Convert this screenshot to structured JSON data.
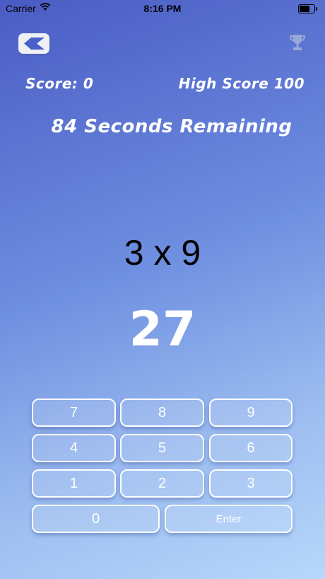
{
  "status_bar": {
    "carrier": "Carrier",
    "time": "8:16 PM",
    "battery_level": 0.8
  },
  "header": {
    "back_icon": "back-chevron-icon",
    "trophy_icon": "trophy-icon"
  },
  "game": {
    "score": "Score: 0",
    "high_score": "High Score 100",
    "timer": "84 Seconds Remaining",
    "question": "3 x 9",
    "answer": "27"
  },
  "keypad": {
    "k7": "7",
    "k8": "8",
    "k9": "9",
    "k4": "4",
    "k5": "5",
    "k6": "6",
    "k1": "1",
    "k2": "2",
    "k3": "3",
    "k0": "0",
    "enter": "Enter"
  },
  "colors": {
    "accent": "#4a5cc4",
    "key_border": "#ffffff"
  }
}
